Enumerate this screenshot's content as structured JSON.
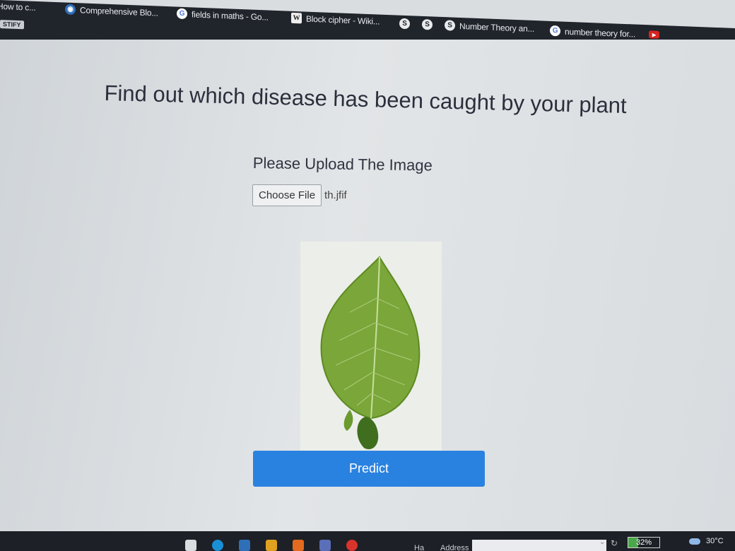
{
  "bookmarks": [
    {
      "label": "How to c...",
      "icon": "none-icon"
    },
    {
      "label": "Comprehensive Blo...",
      "icon": "globe-icon"
    },
    {
      "label": "fields in maths - Go...",
      "icon": "google-icon"
    },
    {
      "label": "Block cipher - Wiki...",
      "icon": "wikipedia-icon"
    },
    {
      "label": "",
      "icon": "link-icon"
    },
    {
      "label": "",
      "icon": "link-icon"
    },
    {
      "label": "Number Theory an...",
      "icon": "link-icon"
    },
    {
      "label": "number theory for...",
      "icon": "google-icon"
    },
    {
      "label": "",
      "icon": "youtube-icon"
    }
  ],
  "bookmark_folder": "STIFY",
  "page": {
    "title": "Find out which disease has been caught by your plant",
    "upload_label": "Please Upload The Image",
    "choose_file_label": "Choose File",
    "selected_file": "th.jfif",
    "predict_label": "Predict"
  },
  "taskbar": {
    "address_label": "Address",
    "partial_label": "Ha",
    "battery": "32%",
    "battery_level": 0.32,
    "temperature": "30°C"
  },
  "colors": {
    "bookmarks_bar": "#20242b",
    "predict_button": "#2a82e0",
    "leaf": "#7aa63a"
  }
}
